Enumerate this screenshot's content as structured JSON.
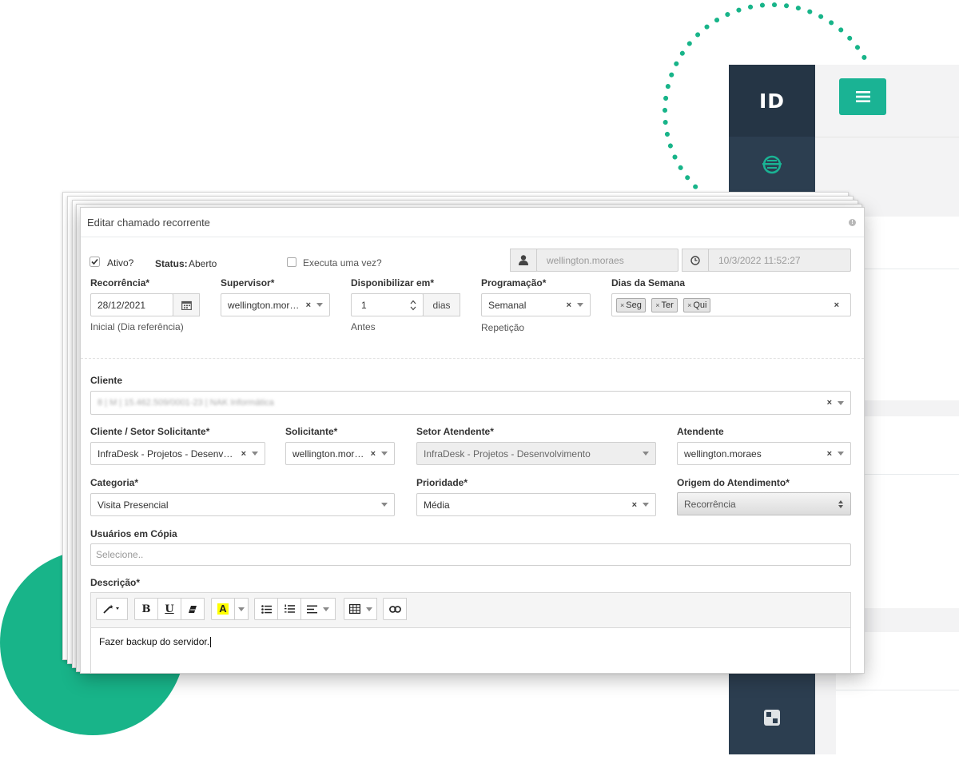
{
  "app": {
    "logo": "ID",
    "colors": {
      "accent": "#1ab394",
      "sidebar": "#2c3e50",
      "deco": "#18b489"
    }
  },
  "modal": {
    "title": "Editar chamado recorrente",
    "ativo_label": "Ativo?",
    "status_label": "Status:",
    "status_value": "Aberto",
    "executa_label": "Executa uma vez?",
    "user_value": "wellington.moraes",
    "datetime_value": "10/3/2022 11:52:27",
    "recorrencia": {
      "label": "Recorrência*",
      "value": "28/12/2021",
      "help": "Inicial (Dia referência)"
    },
    "supervisor": {
      "label": "Supervisor*",
      "value": "wellington.moraes"
    },
    "disponibilizar": {
      "label": "Disponibilizar em*",
      "value": "1",
      "unit": "dias",
      "help": "Antes"
    },
    "programacao": {
      "label": "Programação*",
      "value": "Semanal",
      "help": "Repetição"
    },
    "dias_semana": {
      "label": "Dias da Semana",
      "tags": [
        "Seg",
        "Ter",
        "Qui"
      ]
    },
    "cliente": {
      "label": "Cliente",
      "value": "8 | M | 15.462.509/0001-23 | NAK Informática"
    },
    "cliente_setor": {
      "label": "Cliente / Setor Solicitante*",
      "value": "InfraDesk - Projetos - Desenvolvi..."
    },
    "solicitante": {
      "label": "Solicitante*",
      "value": "wellington.moraes"
    },
    "setor_atendente": {
      "label": "Setor Atendente*",
      "value": "InfraDesk - Projetos - Desenvolvimento"
    },
    "atendente": {
      "label": "Atendente",
      "value": "wellington.moraes"
    },
    "categoria": {
      "label": "Categoria*",
      "value": "Visita Presencial"
    },
    "prioridade": {
      "label": "Prioridade*",
      "value": "Média"
    },
    "origem": {
      "label": "Origem do Atendimento*",
      "value": "Recorrência"
    },
    "usuarios_copia": {
      "label": "Usuários em Cópia",
      "placeholder": "Selecione.."
    },
    "descricao": {
      "label": "Descrição*",
      "content": "Fazer backup do servidor."
    },
    "toolbar_icons": [
      "magic-wand-icon",
      "bold-icon",
      "underline-icon",
      "eraser-icon",
      "text-color-icon",
      "unordered-list-icon",
      "ordered-list-icon",
      "align-icon",
      "table-icon",
      "link-icon"
    ],
    "toolbar_text": {
      "bold": "B",
      "underline": "U",
      "color": "A"
    }
  }
}
